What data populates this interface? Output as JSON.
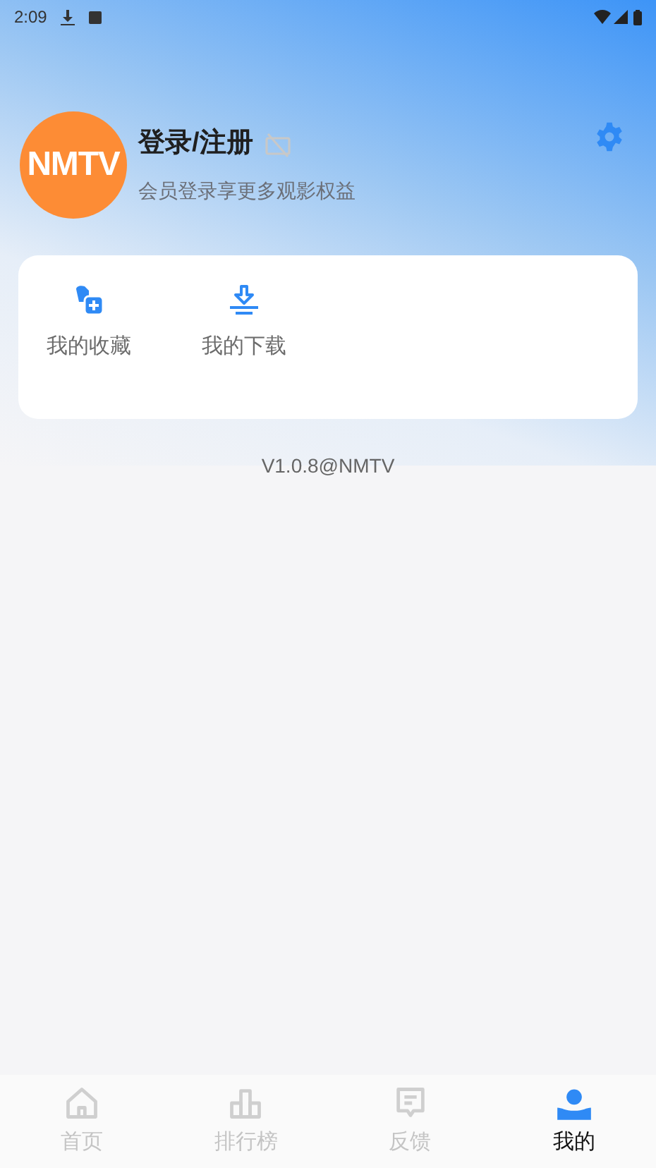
{
  "status_bar": {
    "time": "2:09"
  },
  "profile": {
    "avatar_text": "NMTV",
    "title": "登录/注册",
    "vip": false,
    "subtitle": "会员登录享更多观影权益"
  },
  "shortcuts": [
    {
      "kind": "favorites",
      "label": "我的收藏"
    },
    {
      "kind": "downloads",
      "label": "我的下载"
    }
  ],
  "version": "V1.0.8@NMTV",
  "tabs": [
    {
      "kind": "home",
      "label": "首页",
      "selected": false
    },
    {
      "kind": "ranking",
      "label": "排行榜",
      "selected": false
    },
    {
      "kind": "feedback",
      "label": "反馈",
      "selected": false
    },
    {
      "kind": "mine",
      "label": "我的",
      "selected": true
    }
  ]
}
